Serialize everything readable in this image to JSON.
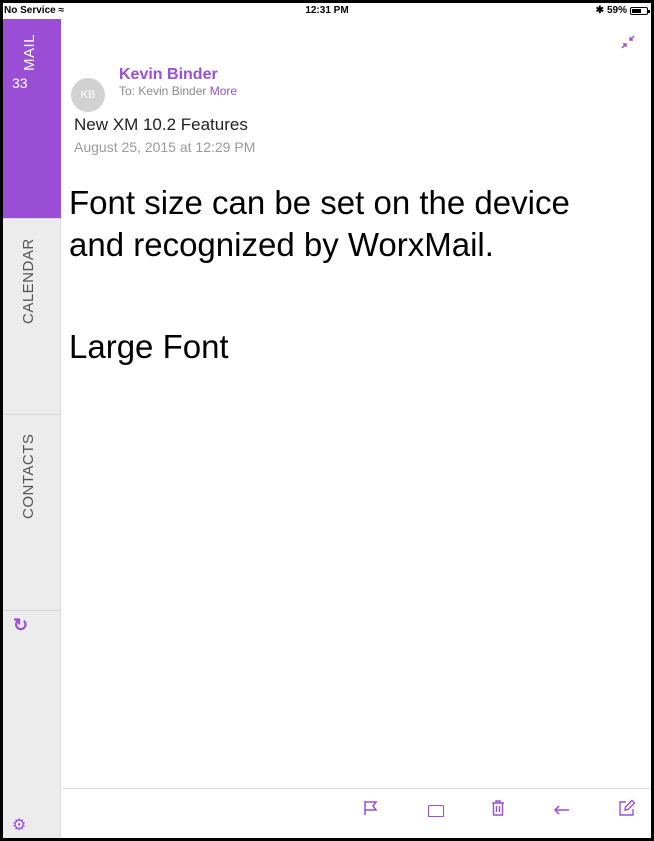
{
  "status_bar": {
    "carrier": "No Service",
    "time": "12:31 PM",
    "battery": "59%",
    "bluetooth_icon": "bluetooth-icon",
    "wifi_icon": "wifi-icon"
  },
  "sidebar": {
    "mail": {
      "label": "MAIL",
      "count": "33"
    },
    "calendar": {
      "label": "CALENDAR"
    },
    "contacts": {
      "label": "CONTACTS"
    },
    "refresh_icon": "refresh-icon",
    "settings_icon": "gear-icon"
  },
  "email": {
    "avatar_initials": "KB",
    "sender": "Kevin Binder",
    "to_prefix": "To: Kevin Binder",
    "more_link": "More",
    "subject": "New XM 10.2 Features",
    "date": "August 25, 2015 at 12:29 PM",
    "body_line1": "Font size can be set on the device",
    "body_line2": "and recognized by WorxMail.",
    "body_line3": "Large Font"
  },
  "toolbar": {
    "icons": [
      "flag-icon",
      "folder-icon",
      "trash-icon",
      "reply-icon",
      "compose-icon"
    ]
  },
  "colors": {
    "accent": "#9a4ed6",
    "sidebar_bg": "#ececec"
  }
}
